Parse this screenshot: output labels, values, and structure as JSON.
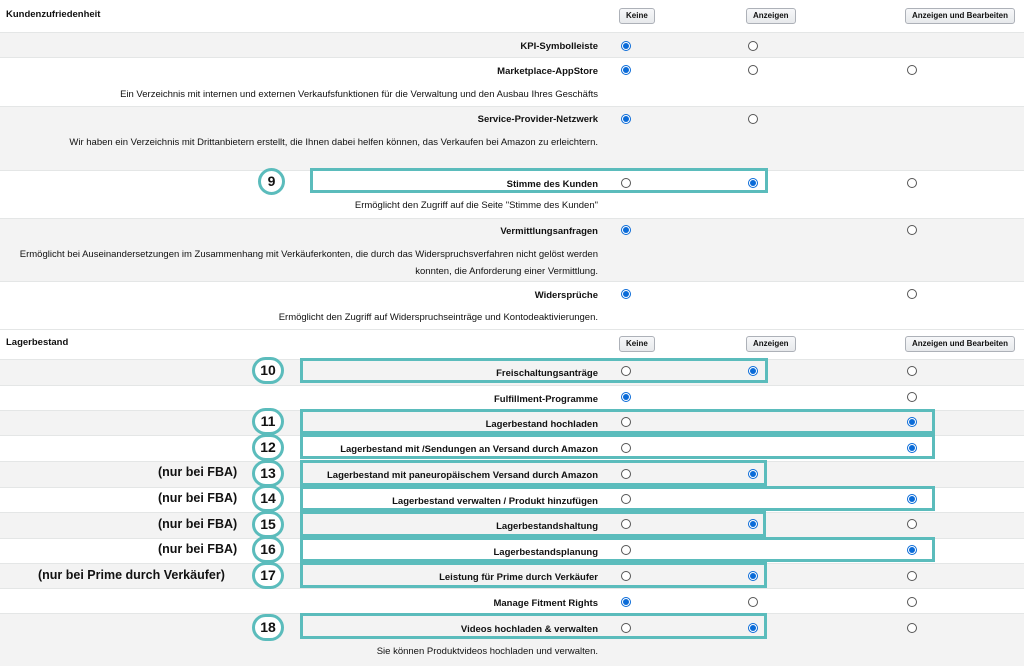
{
  "sections": {
    "kundenzufriedenheit": "Kundenzufriedenheit",
    "lagerbestand": "Lagerbestand"
  },
  "columns": {
    "keine": "Keine",
    "anzeigen": "Anzeigen",
    "anzeigen_bearbeiten": "Anzeigen und Bearbeiten"
  },
  "permissions": {
    "kpi": {
      "label": "KPI-Symbolleiste",
      "selected": "keine"
    },
    "marketplace": {
      "label": "Marketplace-AppStore",
      "desc": "Ein Verzeichnis mit internen und externen Verkaufsfunktionen für die Verwaltung und den Ausbau Ihres Geschäfts",
      "selected": "keine"
    },
    "service": {
      "label": "Service-Provider-Netzwerk",
      "desc": "Wir haben ein Verzeichnis mit Drittanbietern erstellt, die Ihnen dabei helfen können, das Verkaufen bei Amazon zu erleichtern.",
      "selected": "keine"
    },
    "stimme": {
      "label": "Stimme des Kunden",
      "desc": "Ermöglicht den Zugriff auf die Seite \"Stimme des Kunden\"",
      "selected": "anzeigen"
    },
    "vermittlung": {
      "label": "Vermittlungsanfragen",
      "desc": "Ermöglicht bei Auseinandersetzungen im Zusammenhang mit Verkäuferkonten, die durch das Widerspruchsverfahren nicht gelöst werden konnten, die Anforderung einer Vermittlung.",
      "selected": "keine"
    },
    "widersprueche": {
      "label": "Widersprüche",
      "desc": "Ermöglicht den Zugriff auf Widerspruchseinträge und Kontodeaktivierungen.",
      "selected": "keine"
    },
    "freischaltung": {
      "label": "Freischaltungsanträge",
      "selected": "anzeigen"
    },
    "fulfillment": {
      "label": "Fulfillment-Programme",
      "selected": "keine"
    },
    "hochladen": {
      "label": "Lagerbestand hochladen",
      "selected": "anzeigen_bearbeiten"
    },
    "versand": {
      "label": "Lagerbestand mit /Sendungen an Versand durch Amazon",
      "selected": "anzeigen_bearbeiten"
    },
    "paneuro": {
      "label": "Lagerbestand mit paneuropäischem Versand durch Amazon",
      "selected": "anzeigen"
    },
    "verwalten": {
      "label": "Lagerbestand verwalten / Produkt hinzufügen",
      "selected": "anzeigen_bearbeiten"
    },
    "haltung": {
      "label": "Lagerbestandshaltung",
      "selected": "anzeigen"
    },
    "planung": {
      "label": "Lagerbestandsplanung",
      "selected": "anzeigen_bearbeiten"
    },
    "prime": {
      "label": "Leistung für Prime durch Verkäufer",
      "selected": "anzeigen"
    },
    "fitment": {
      "label": "Manage Fitment Rights",
      "selected": "keine"
    },
    "videos": {
      "label": "Videos hochladen & verwalten",
      "desc": "Sie können Produktvideos hochladen und verwalten.",
      "selected": "anzeigen"
    }
  },
  "annotations": {
    "b9": "9",
    "b10": "10",
    "b11": "11",
    "b12": "12",
    "b13": "13",
    "b14": "14",
    "b15": "15",
    "b16": "16",
    "b17": "17",
    "b18": "18",
    "fba": "(nur bei FBA)",
    "prime_note": "(nur bei Prime durch Verkäufer)"
  },
  "colors": {
    "highlight": "#5bbcbc",
    "radio_selected": "#0a6bd8",
    "row_alt": "#f3f3f3"
  }
}
